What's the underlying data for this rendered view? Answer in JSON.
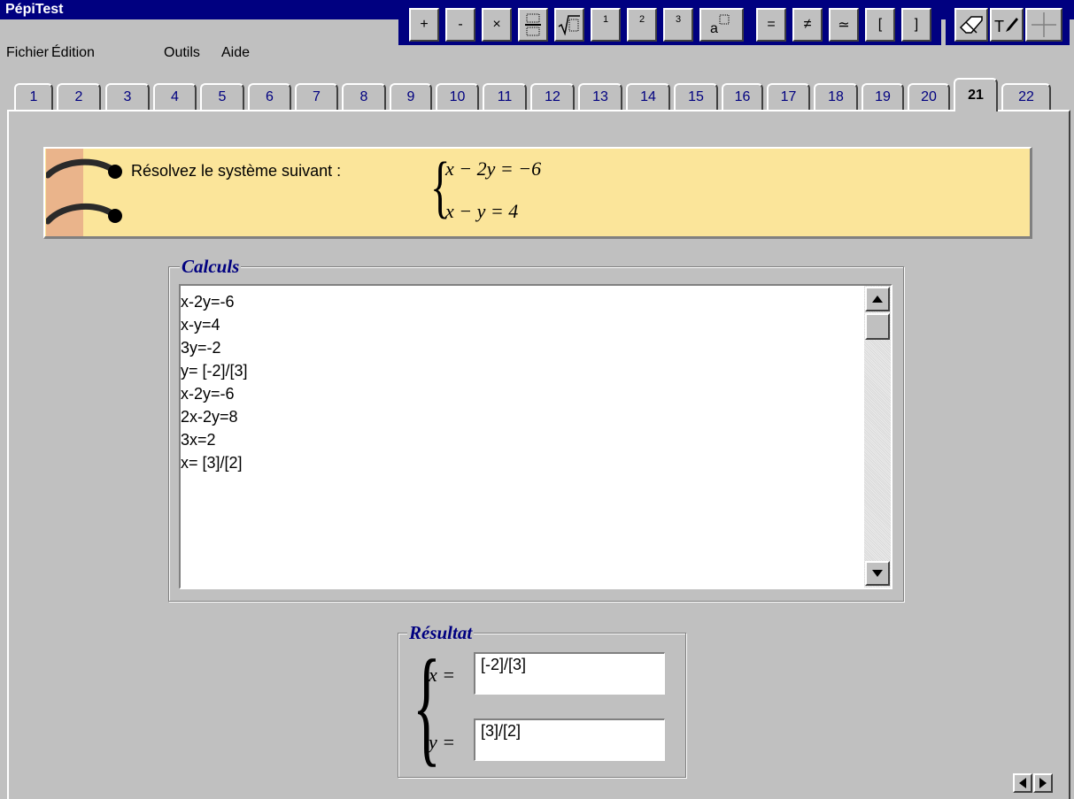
{
  "app": {
    "title": "PépiTest"
  },
  "menu": [
    {
      "label": "Fichier"
    },
    {
      "label": "Édition"
    },
    {
      "label": "Outils"
    },
    {
      "label": "Aide"
    }
  ],
  "toolbar_math": {
    "plus": "+",
    "minus": "-",
    "times": "×",
    "power1": "1",
    "power2": "2",
    "power3": "3",
    "equals": "=",
    "not_equal": "≠",
    "approx": "≃",
    "bracket_open": "[",
    "bracket_close": "]"
  },
  "tabs": [
    "1",
    "2",
    "3",
    "4",
    "5",
    "6",
    "7",
    "8",
    "9",
    "10",
    "11",
    "12",
    "13",
    "14",
    "15",
    "16",
    "17",
    "18",
    "19",
    "20",
    "21",
    "22"
  ],
  "active_tab": "21",
  "question": {
    "prompt": "Résolvez le système suivant :",
    "eq1": "x − 2y = −6",
    "eq2": "x − y = 4"
  },
  "calculs": {
    "title": "Calculs",
    "lines": [
      "x-2y=-6",
      "x-y=4",
      "3y=-2",
      "y= [-2]/[3]",
      "x-2y=-6",
      "2x-2y=8",
      "3x=2",
      "x= [3]/[2]"
    ]
  },
  "resultat": {
    "title": "Résultat",
    "x_label": "x =",
    "x_value": "[-2]/[3]",
    "y_label": "y =",
    "y_value": "[3]/[2]"
  }
}
